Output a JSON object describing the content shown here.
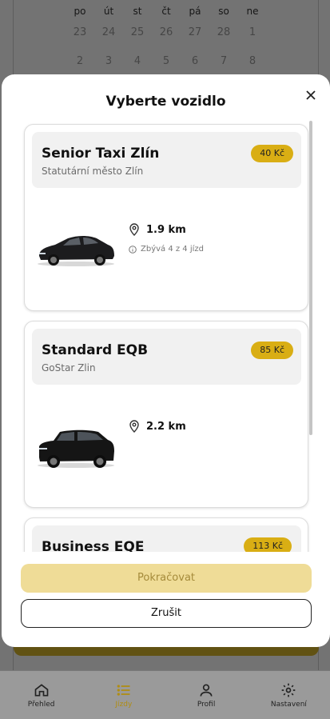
{
  "calendar": {
    "weekdays": [
      "po",
      "út",
      "st",
      "čt",
      "pá",
      "so",
      "ne"
    ],
    "week1": [
      "23",
      "24",
      "25",
      "26",
      "27",
      "28",
      "1"
    ],
    "week2": [
      "2",
      "3",
      "4",
      "5",
      "6",
      "7",
      "8"
    ]
  },
  "modal": {
    "title": "Vyberte vozidlo",
    "close_icon": "close-icon",
    "vehicles": [
      {
        "name": "Senior Taxi Zlín",
        "company": "Statutární město Zlín",
        "price": "40 Kč",
        "distance": "1.9 km",
        "rides": "Zbývá 4 z 4 jízd",
        "car_color": "#1c1c1e"
      },
      {
        "name": "Standard EQB",
        "company": "GoStar Zlin",
        "price": "85 Kč",
        "distance": "2.2 km",
        "car_color": "#151515"
      },
      {
        "name": "Business EQE",
        "price": "113 Kč"
      }
    ],
    "continue_label": "Pokračovat",
    "cancel_label": "Zrušit"
  },
  "nav": {
    "items": [
      {
        "label": "Přehled",
        "icon": "home-icon"
      },
      {
        "label": "Jízdy",
        "icon": "list-icon",
        "active": true
      },
      {
        "label": "Profil",
        "icon": "user-icon"
      },
      {
        "label": "Nastavení",
        "icon": "gear-icon"
      }
    ]
  },
  "colors": {
    "accent": "#d9ae14",
    "continue_disabled_bg": "#efdc97",
    "nav_active": "#b08d12"
  }
}
